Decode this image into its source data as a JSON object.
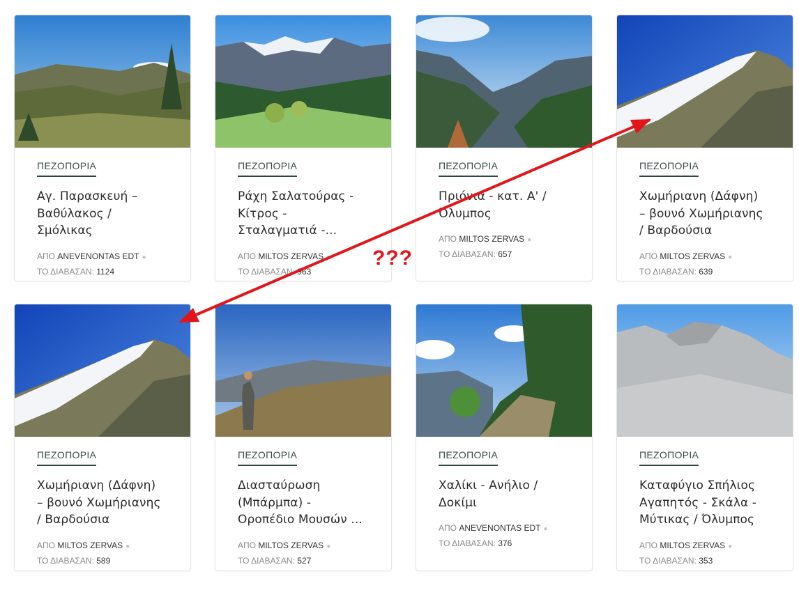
{
  "cards": [
    {
      "category": "ΠΕΖΟΠΟΡΙΑ",
      "title_lines": [
        "Αγ. Παρασκευή –",
        "Βαθύλακος /",
        "Σμόλικας"
      ],
      "by_label": "ΑΠΟ",
      "author": "ANEVENONTAS EDT",
      "views_label": "ΤΟ ΔΙΑΒΑΣΑΝ:",
      "views": "1124"
    },
    {
      "category": "ΠΕΖΟΠΟΡΙΑ",
      "title_lines": [
        "Ράχη Σαλατούρας -",
        "Κίτρος -",
        "Σταλαγματιά -..."
      ],
      "by_label": "ΑΠΟ",
      "author": "MILTOS ZERVAS",
      "views_label": "ΤΟ ΔΙΑΒΑΣΑΝ:",
      "views": "963"
    },
    {
      "category": "ΠΕΖΟΠΟΡΙΑ",
      "title_lines": [
        "Πριόνια - κατ. Α' /",
        "Όλυμπος"
      ],
      "by_label": "ΑΠΟ",
      "author": "MILTOS ZERVAS",
      "views_label": "ΤΟ ΔΙΑΒΑΣΑΝ:",
      "views": "657"
    },
    {
      "category": "ΠΕΖΟΠΟΡΙΑ",
      "title_lines": [
        "Χωμήριανη (Δάφνη)",
        "– βουνό Χωμήριανης",
        "/ Βαρδούσια"
      ],
      "by_label": "ΑΠΟ",
      "author": "MILTOS ZERVAS",
      "views_label": "ΤΟ ΔΙΑΒΑΣΑΝ:",
      "views": "639"
    },
    {
      "category": "ΠΕΖΟΠΟΡΙΑ",
      "title_lines": [
        "Χωμήριανη (Δάφνη)",
        "– βουνό Χωμήριανης",
        "/ Βαρδούσια"
      ],
      "by_label": "ΑΠΟ",
      "author": "MILTOS ZERVAS",
      "views_label": "ΤΟ ΔΙΑΒΑΣΑΝ:",
      "views": "589"
    },
    {
      "category": "ΠΕΖΟΠΟΡΙΑ",
      "title_lines": [
        "Διασταύρωση",
        "(Μπάρμπα) -",
        "Οροπέδιο Μουσών ..."
      ],
      "by_label": "ΑΠΟ",
      "author": "MILTOS ZERVAS",
      "views_label": "ΤΟ ΔΙΑΒΑΣΑΝ:",
      "views": "527"
    },
    {
      "category": "ΠΕΖΟΠΟΡΙΑ",
      "title_lines": [
        "Χαλίκι - Ανήλιο /",
        "Δοκίμι"
      ],
      "by_label": "ΑΠΟ",
      "author": "ANEVENONTAS EDT",
      "views_label": "ΤΟ ΔΙΑΒΑΣΑΝ:",
      "views": "376"
    },
    {
      "category": "ΠΕΖΟΠΟΡΙΑ",
      "title_lines": [
        "Καταφύγιο Σπήλιος",
        "Αγαπητός - Σκάλα -",
        "Μύτικας / Όλυμπος"
      ],
      "by_label": "ΑΠΟ",
      "author": "MILTOS ZERVAS",
      "views_label": "ΤΟ ΔΙΑΒΑΣΑΝ:",
      "views": "353"
    }
  ],
  "annotation": {
    "text": "???",
    "color": "#e0161b"
  },
  "colors": {
    "category_underline": "#2f4a46",
    "arrow": "#e0161b"
  }
}
